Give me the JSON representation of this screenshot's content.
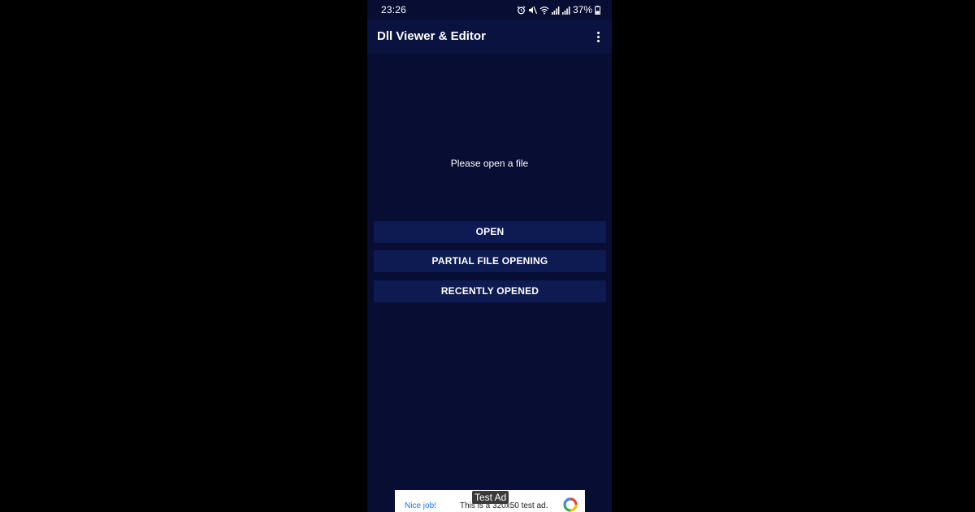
{
  "status_bar": {
    "time": "23:26",
    "battery": "37%",
    "icons": [
      "alarm-icon",
      "mute-icon",
      "wifi-icon",
      "signal-icon",
      "signal-icon",
      "battery-icon"
    ]
  },
  "app_bar": {
    "title": "Dll Viewer & Editor",
    "menu_icon": "more-vert-icon"
  },
  "main": {
    "empty_message": "Please open a file",
    "buttons": {
      "open": "OPEN",
      "partial": "PARTIAL FILE OPENING",
      "recent": "RECENTLY OPENED"
    }
  },
  "ad": {
    "label": "Test Ad",
    "nice_job": "Nice job!",
    "text": "This is a 320x50 test ad."
  },
  "colors": {
    "background": "#070d33",
    "app_bar": "#0a1240",
    "button": "#0e1a52",
    "letterbox": "#000000"
  }
}
